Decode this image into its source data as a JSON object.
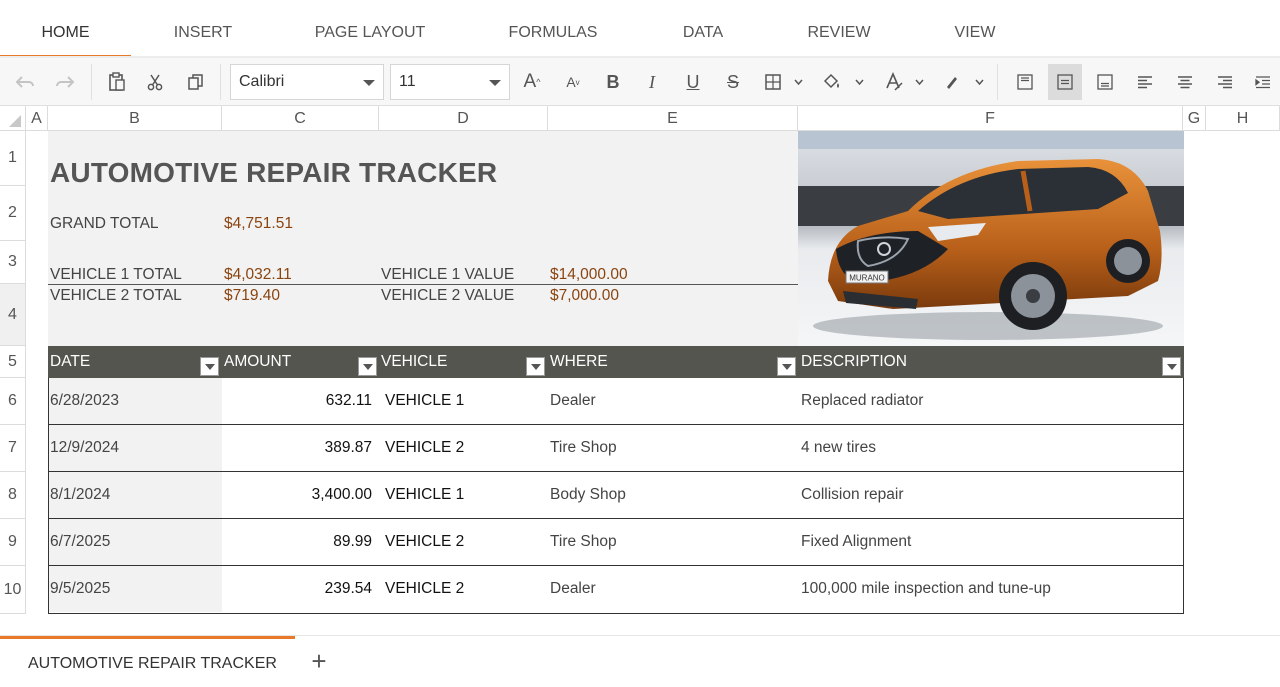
{
  "ribbon": {
    "tabs": [
      "HOME",
      "INSERT",
      "PAGE LAYOUT",
      "FORMULAS",
      "DATA",
      "REVIEW",
      "VIEW"
    ],
    "active_tab": "HOME",
    "accent": "#e8792a"
  },
  "toolbar": {
    "font_name": "Calibri",
    "font_size": "11",
    "icons": [
      "undo-icon",
      "redo-icon",
      "paste-icon",
      "cut-icon",
      "copy-icon",
      "increase-font-icon",
      "decrease-font-icon",
      "bold-icon",
      "italic-icon",
      "underline-icon",
      "strikethrough-icon",
      "borders-icon",
      "fill-color-icon",
      "font-color-icon",
      "highlight-icon",
      "align-top-icon",
      "align-middle-icon",
      "align-bottom-icon",
      "align-left-icon",
      "align-center-icon",
      "align-right-icon",
      "indent-icon"
    ],
    "bold": "B",
    "italic": "I",
    "underline": "U",
    "strike": "S",
    "increase_font": "A",
    "decrease_font": "A"
  },
  "grid": {
    "columns": [
      "A",
      "B",
      "C",
      "D",
      "E",
      "F",
      "G",
      "H"
    ],
    "rows": [
      "1",
      "2",
      "3",
      "4",
      "5",
      "6",
      "7",
      "8",
      "9",
      "10"
    ]
  },
  "sheet": {
    "title": "AUTOMOTIVE REPAIR TRACKER",
    "grand_total_label": "GRAND TOTAL",
    "grand_total": "$4,751.51",
    "vehicle1_total_label": "VEHICLE 1 TOTAL",
    "vehicle1_total": "$4,032.11",
    "vehicle2_total_label": "VEHICLE 2 TOTAL",
    "vehicle2_total": "$719.40",
    "vehicle1_value_label": "VEHICLE 1  VALUE",
    "vehicle1_value": "$14,000.00",
    "vehicle2_value_label": "VEHICLE 2  VALUE",
    "vehicle2_value": "$7,000.00",
    "money_color": "#8a4410",
    "header_bg": "#555550"
  },
  "table": {
    "headers": [
      "DATE",
      "AMOUNT",
      "VEHICLE",
      "WHERE",
      "DESCRIPTION"
    ],
    "rows": [
      {
        "date": "6/28/2023",
        "amount": "632.11",
        "vehicle": "VEHICLE 1",
        "where": "Dealer",
        "description": "Replaced radiator"
      },
      {
        "date": "12/9/2024",
        "amount": "389.87",
        "vehicle": "VEHICLE 2",
        "where": "Tire Shop",
        "description": "4 new tires"
      },
      {
        "date": "8/1/2024",
        "amount": "3,400.00",
        "vehicle": "VEHICLE 1",
        "where": "Body Shop",
        "description": "Collision repair"
      },
      {
        "date": "6/7/2025",
        "amount": "89.99",
        "vehicle": "VEHICLE 2",
        "where": "Tire Shop",
        "description": "Fixed Alignment"
      },
      {
        "date": "9/5/2025",
        "amount": "239.54",
        "vehicle": "VEHICLE 2",
        "where": "Dealer",
        "description": "100,000 mile inspection and tune-up"
      }
    ]
  },
  "image": {
    "plate_text": "MURANO",
    "car_color": "#c8701e"
  },
  "sheet_tabs": {
    "tabs": [
      "AUTOMOTIVE REPAIR TRACKER"
    ],
    "add_label": "+"
  }
}
